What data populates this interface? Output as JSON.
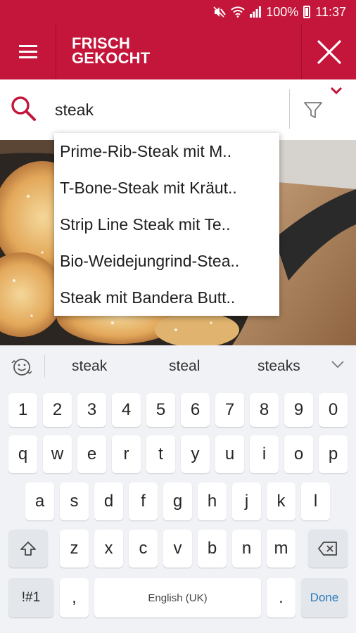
{
  "status_bar": {
    "battery": "100%",
    "time": "11:37",
    "icons": [
      "mute-icon",
      "wifi-icon",
      "signal-icon",
      "battery-icon"
    ]
  },
  "app_bar": {
    "logo_line1": "FRISCH",
    "logo_line2": "GEKOCHT",
    "brand_color": "#c4153a",
    "icons": [
      "menu-icon",
      "close-icon"
    ]
  },
  "search": {
    "query": "steak",
    "icons": [
      "search-icon",
      "filter-icon",
      "chevron-down-icon"
    ]
  },
  "suggestions": [
    "Prime-Rib-Steak mit M..",
    "T-Bone-Steak mit Kräut..",
    "Strip Line Steak mit Te..",
    "Bio-Weidejungrind-Stea..",
    "Steak mit Bandera Butt.."
  ],
  "keyboard": {
    "predictions": [
      "steak",
      "steal",
      "steaks"
    ],
    "number_row": [
      "1",
      "2",
      "3",
      "4",
      "5",
      "6",
      "7",
      "8",
      "9",
      "0"
    ],
    "row1": [
      "q",
      "w",
      "e",
      "r",
      "t",
      "y",
      "u",
      "i",
      "o",
      "p"
    ],
    "row2": [
      "a",
      "s",
      "d",
      "f",
      "g",
      "h",
      "j",
      "k",
      "l"
    ],
    "row3": [
      "z",
      "x",
      "c",
      "v",
      "b",
      "n",
      "m"
    ],
    "symbols_label": "!#1",
    "comma": ",",
    "space_label": "English (UK)",
    "period": ".",
    "done_label": "Done",
    "icons": [
      "emoji-icon",
      "collapse-icon",
      "shift-icon",
      "backspace-icon"
    ]
  }
}
